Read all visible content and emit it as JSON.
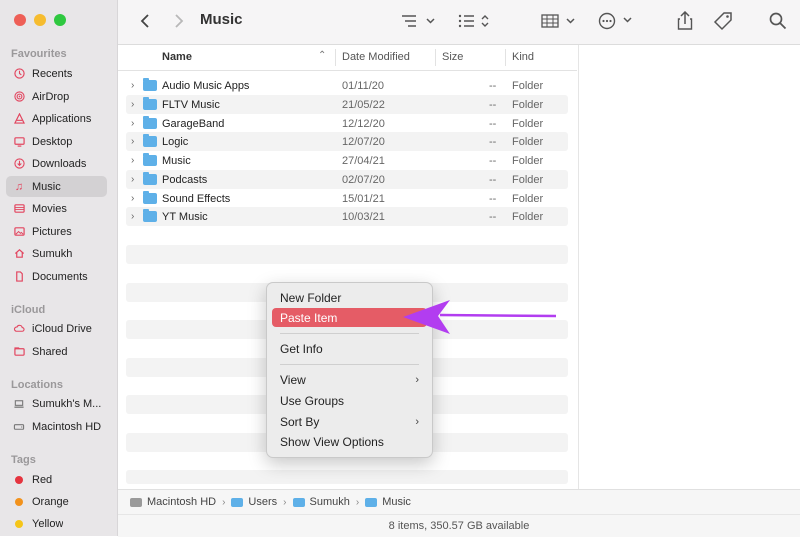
{
  "window": {
    "title": "Music"
  },
  "sidebar": {
    "favourites_heading": "Favourites",
    "favourites": [
      {
        "label": "Recents",
        "icon": "clock-icon"
      },
      {
        "label": "AirDrop",
        "icon": "airdrop-icon"
      },
      {
        "label": "Applications",
        "icon": "applications-icon"
      },
      {
        "label": "Desktop",
        "icon": "desktop-icon"
      },
      {
        "label": "Downloads",
        "icon": "download-icon"
      },
      {
        "label": "Music",
        "icon": "music-note-icon",
        "active": true
      },
      {
        "label": "Movies",
        "icon": "film-icon"
      },
      {
        "label": "Pictures",
        "icon": "photo-icon"
      },
      {
        "label": "Sumukh",
        "icon": "home-icon"
      },
      {
        "label": "Documents",
        "icon": "document-icon"
      }
    ],
    "icloud_heading": "iCloud",
    "icloud": [
      {
        "label": "iCloud Drive",
        "icon": "cloud-icon"
      },
      {
        "label": "Shared",
        "icon": "shared-folder-icon"
      }
    ],
    "locations_heading": "Locations",
    "locations": [
      {
        "label": "Sumukh's M...",
        "icon": "laptop-icon"
      },
      {
        "label": "Macintosh HD",
        "icon": "disk-icon"
      }
    ],
    "tags_heading": "Tags",
    "tags": [
      {
        "label": "Red",
        "color": "#e5343f"
      },
      {
        "label": "Orange",
        "color": "#f2921c"
      },
      {
        "label": "Yellow",
        "color": "#f5c518"
      }
    ]
  },
  "list": {
    "columns": {
      "name": "Name",
      "date": "Date Modified",
      "size": "Size",
      "kind": "Kind"
    },
    "rows": [
      {
        "name": "Audio Music Apps",
        "date": "01/11/20",
        "size": "--",
        "kind": "Folder"
      },
      {
        "name": "FLTV Music",
        "date": "21/05/22",
        "size": "--",
        "kind": "Folder"
      },
      {
        "name": "GarageBand",
        "date": "12/12/20",
        "size": "--",
        "kind": "Folder"
      },
      {
        "name": "Logic",
        "date": "12/07/20",
        "size": "--",
        "kind": "Folder"
      },
      {
        "name": "Music",
        "date": "27/04/21",
        "size": "--",
        "kind": "Folder"
      },
      {
        "name": "Podcasts",
        "date": "02/07/20",
        "size": "--",
        "kind": "Folder"
      },
      {
        "name": "Sound Effects",
        "date": "15/01/21",
        "size": "--",
        "kind": "Folder"
      },
      {
        "name": "YT Music",
        "date": "10/03/21",
        "size": "--",
        "kind": "Folder"
      }
    ]
  },
  "pathbar": {
    "items": [
      "Macintosh HD",
      "Users",
      "Sumukh",
      "Music"
    ]
  },
  "status": {
    "text": "8 items, 350.57 GB available"
  },
  "context_menu": {
    "new_folder": "New Folder",
    "paste_item": "Paste Item",
    "get_info": "Get Info",
    "view": "View",
    "use_groups": "Use Groups",
    "sort_by": "Sort By",
    "show_view_options": "Show View Options"
  },
  "colors": {
    "accent": "#e55c66",
    "arrow": "#b23df0",
    "folder": "#5eb0e8"
  }
}
